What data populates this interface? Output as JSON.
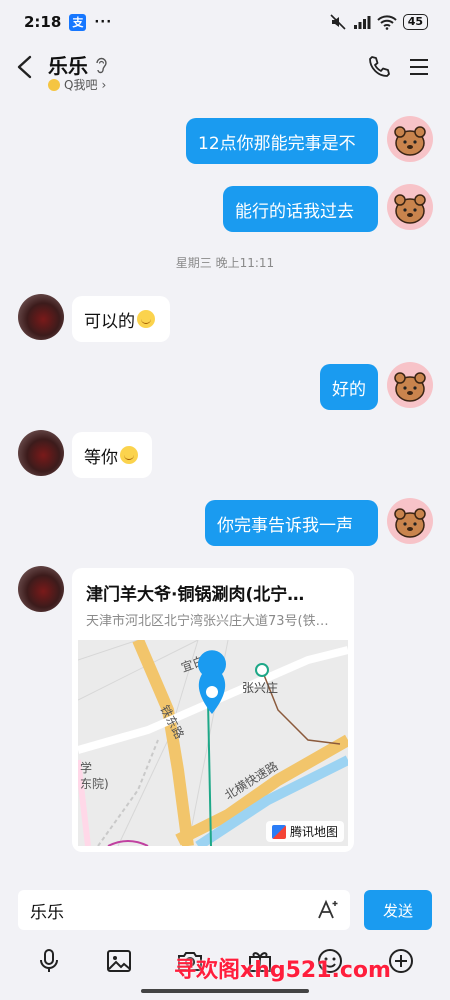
{
  "status": {
    "time": "2:18",
    "app_badge": "支",
    "dots": "···",
    "battery": "45"
  },
  "header": {
    "title": "乐乐",
    "subtitle": "Q我吧",
    "subtitle_chevron": "›"
  },
  "messages": [
    {
      "from": "me",
      "text": "12点你那能完事是不"
    },
    {
      "from": "me",
      "text": "能行的话我过去"
    },
    {
      "type": "time",
      "text": "星期三 晚上11:11"
    },
    {
      "from": "peer",
      "text": "可以的"
    },
    {
      "from": "me",
      "text": "好的"
    },
    {
      "from": "peer",
      "text": "等你"
    },
    {
      "from": "me",
      "text": "你完事告诉我一声"
    },
    {
      "from": "peer",
      "type": "location"
    }
  ],
  "location": {
    "title": "津门羊大爷·铜锅涮肉(北宁…",
    "address": "天津市河北区北宁湾张兴庄大道73号(铁…",
    "provider": "腾讯地图",
    "labels": {
      "guanbai": "宜白路",
      "zhangxing": "张兴庄",
      "tiedong": "铁东路",
      "beiheng": "北横快速路",
      "xue": "学",
      "yuan": "东院)"
    }
  },
  "input": {
    "value": "乐乐",
    "send_label": "发送"
  },
  "toolbar": [
    "mic-icon",
    "image-icon",
    "camera-icon",
    "gift-icon",
    "emoji-icon",
    "plus-icon"
  ],
  "watermark": "寻欢阁xhg521.com",
  "colors": {
    "accent": "#1a9bf0",
    "background": "#f2f2f6"
  }
}
